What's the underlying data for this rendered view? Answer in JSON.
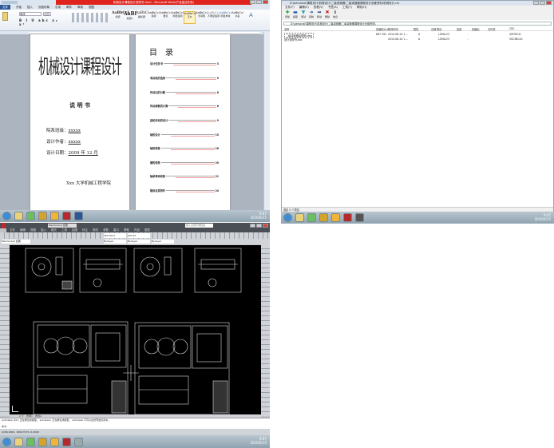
{
  "word": {
    "title": "机械设计课程设计说明书.docx - Microsoft Word(产品激活失败)",
    "tabs": [
      "文件",
      "开始",
      "插入",
      "页面布局",
      "引用",
      "邮件",
      "审阅",
      "视图"
    ],
    "styles": [
      "AaBbCcI",
      "AaBl",
      "AaBbC",
      "AaBbCcI",
      "AaBbCcI",
      "AaBbCcI",
      "AaBbCcI",
      "AaBbCcI",
      "AaBbCcI",
      "AaBbCcI",
      "AaBbCcI"
    ],
    "style_names": [
      "标题",
      "标题1",
      "副标题",
      "强调",
      "要点",
      "明显强调",
      "正文",
      "无间隔",
      "不明显强调",
      "明显参考",
      "书名"
    ],
    "font_name": "宋体",
    "font_size": "小四",
    "accent": "#e0231c",
    "cover": {
      "title": "机械设计课程设计",
      "subtitle": "说 明 书",
      "dept_label": "院系班级：",
      "dept_value": "xxxxx",
      "author_label": "设计作者：",
      "author_value": "xxxxx",
      "date_label": "设计日期：",
      "date_value": "2009 年 12 月",
      "school": "Xxx 大学机械工程学院"
    },
    "toc": {
      "title": "目　录",
      "items": [
        {
          "label": "设计任务书",
          "page": "3"
        },
        {
          "label": "电动机的选择",
          "page": "5"
        },
        {
          "label": "传动比的分配",
          "page": "6"
        },
        {
          "label": "传动参数的计算",
          "page": "6"
        },
        {
          "label": "齿轮传动的设计",
          "page": "9"
        },
        {
          "label": "轴的设计",
          "page": "15"
        },
        {
          "label": "轴的校核",
          "page": "18"
        },
        {
          "label": "键的校核",
          "page": "20"
        },
        {
          "label": "轴承寿命校核",
          "page": "21"
        },
        {
          "label": "箱体及其附件",
          "page": "24"
        }
      ]
    }
  },
  "archive": {
    "title": "D:\\personal\\课程设计\\机械设计\\二级减速器\\二级减速器课程设计全套资料\\机械设计.rar",
    "menu": [
      "文件(F)",
      "编辑(E)",
      "查看(V)",
      "书签(A)",
      "工具(T)",
      "帮助(H)"
    ],
    "toolbar": [
      "添加",
      "提取",
      "测试",
      "复制",
      "移动",
      "删除",
      "信息"
    ],
    "address": "D:\\personal\\课程设计\\机械设计\\二级减速器\\二级减速器课程设计全套资料\\",
    "columns": [
      "名称",
      "压缩前大小",
      "修改时间",
      "属性",
      "注释",
      "算法",
      "加密",
      "压缩后",
      "文件夹",
      "CRC"
    ],
    "rows": [
      {
        "name": "二级减速器装配图.dwg",
        "size": "867 392",
        "modified": "2010-08-24 1...",
        "attr": "A",
        "method": "LZMA:23",
        "encrypted": "-",
        "crc": "49F5E1D"
      },
      {
        "name": "设计说明书.doc",
        "size": "",
        "modified": "2010-08-24 1...",
        "attr": "A",
        "method": "LZMA:23",
        "encrypted": "-",
        "crc": "5023BC40"
      }
    ],
    "status": "选定 0 个项目"
  },
  "cad": {
    "workspace": "Mechanical 经典",
    "search_placeholder": "键入关键字或短语",
    "menu": [
      "文件",
      "编辑",
      "视图",
      "插入",
      "格式",
      "工具",
      "绘图",
      "标注",
      "修改",
      "参数",
      "窗口",
      "帮助",
      "内容",
      "图层"
    ],
    "layer_combo": "ByLayer",
    "style_combo": "Standard",
    "dim_combo": "ISO-25",
    "layout_tabs": [
      "模型",
      "布局1",
      "布局2"
    ],
    "command_history": "autodesk (kb): 正在重生成模型。 autodesk: 正在重生成模型。 autodesk 不可以在世界坐标系中。",
    "command_prompt": "命令:",
    "coords": "2266.1862, 1806.3715, 0.0000",
    "drawing_bg": "#000000"
  },
  "taskbar": {
    "time": "9:47",
    "date": "2016/6/15",
    "color": "#9fb0bc"
  }
}
